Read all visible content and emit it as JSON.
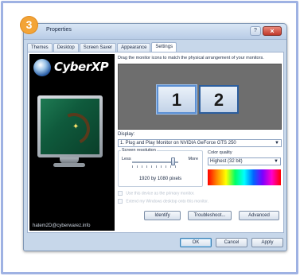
{
  "step_badge": "3",
  "window": {
    "title": "Properties",
    "help_glyph": "?",
    "close_glyph": "×"
  },
  "tabs": [
    {
      "label": "Themes"
    },
    {
      "label": "Desktop"
    },
    {
      "label": "Screen Saver"
    },
    {
      "label": "Appearance"
    },
    {
      "label": "Settings",
      "active": true
    }
  ],
  "banner": {
    "brand": "CyberXP",
    "footer": "hatem2D@cyberwarez.info"
  },
  "settings": {
    "hint": "Drag the monitor icons to match the physical arrangement of your monitors.",
    "monitors": [
      "1",
      "2"
    ],
    "display_label": "Display:",
    "display_value": "1. Plug and Play Monitor on NVIDIA GeForce GTS 250",
    "resolution": {
      "title": "Screen resolution",
      "less": "Less",
      "more": "More",
      "value": "1920 by 1080 pixels",
      "slider_position": 0.85
    },
    "color_quality": {
      "label": "Color quality",
      "value": "Highest (32 bit)"
    },
    "checkboxes": [
      {
        "label": "Use this device as the primary monitor.",
        "checked": false,
        "enabled": false
      },
      {
        "label": "Extend my Windows desktop onto this monitor.",
        "checked": false,
        "enabled": false
      }
    ],
    "buttons": {
      "identify": "Identify",
      "troubleshoot": "Troubleshoot...",
      "advanced": "Advanced"
    }
  },
  "dialog_buttons": {
    "ok": "OK",
    "cancel": "Cancel",
    "apply": "Apply"
  },
  "dropdown_arrow": "▼",
  "colors": {
    "frame_border": "#9fb2e3",
    "badge": "#f3a437",
    "arrange_bg": "#6e6e6e",
    "monitor_border": "#2f6fbd"
  }
}
